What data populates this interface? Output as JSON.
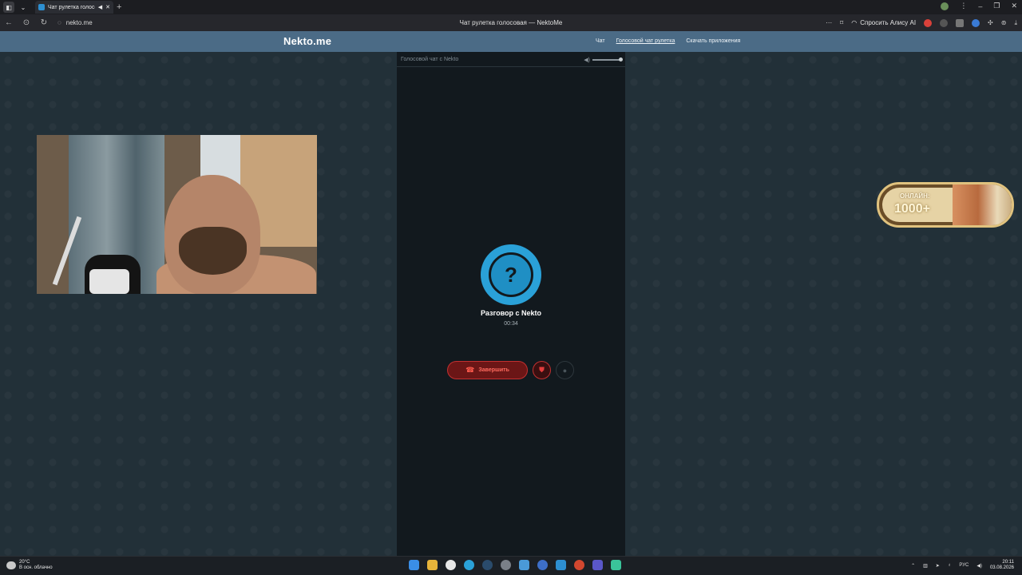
{
  "browser": {
    "tab_title": "Чат рулетка голосов",
    "url": "nekto.me",
    "page_title": "Чат рулетка голосовая — NektoMe",
    "ask_alisa": "Спросить Алису AI"
  },
  "site": {
    "logo": "Nekto.me",
    "nav": [
      {
        "label": "Чат",
        "active": false
      },
      {
        "label": "Голосовой чат рулетка",
        "active": true
      },
      {
        "label": "Скачать приложения",
        "active": false
      }
    ]
  },
  "panel": {
    "header": "Голосовой чат с Nekto",
    "avatar_glyph": "?",
    "title": "Разговор с Nekto",
    "timer": "00:34",
    "end_label": "Завершить",
    "volume_fraction": 1.0
  },
  "online_badge": {
    "label": "ОНЛАЙН:",
    "count": "1000+"
  },
  "taskbar": {
    "temperature": "20°C",
    "weather": "В осн. облачно",
    "language": "РУС",
    "time": "20:11",
    "date": "03.08.2026"
  },
  "colors": {
    "header_bg": "#4b6b86",
    "panel_bg": "#12191e",
    "accent_blue": "#2aa1d8",
    "end_red": "#c23030"
  }
}
